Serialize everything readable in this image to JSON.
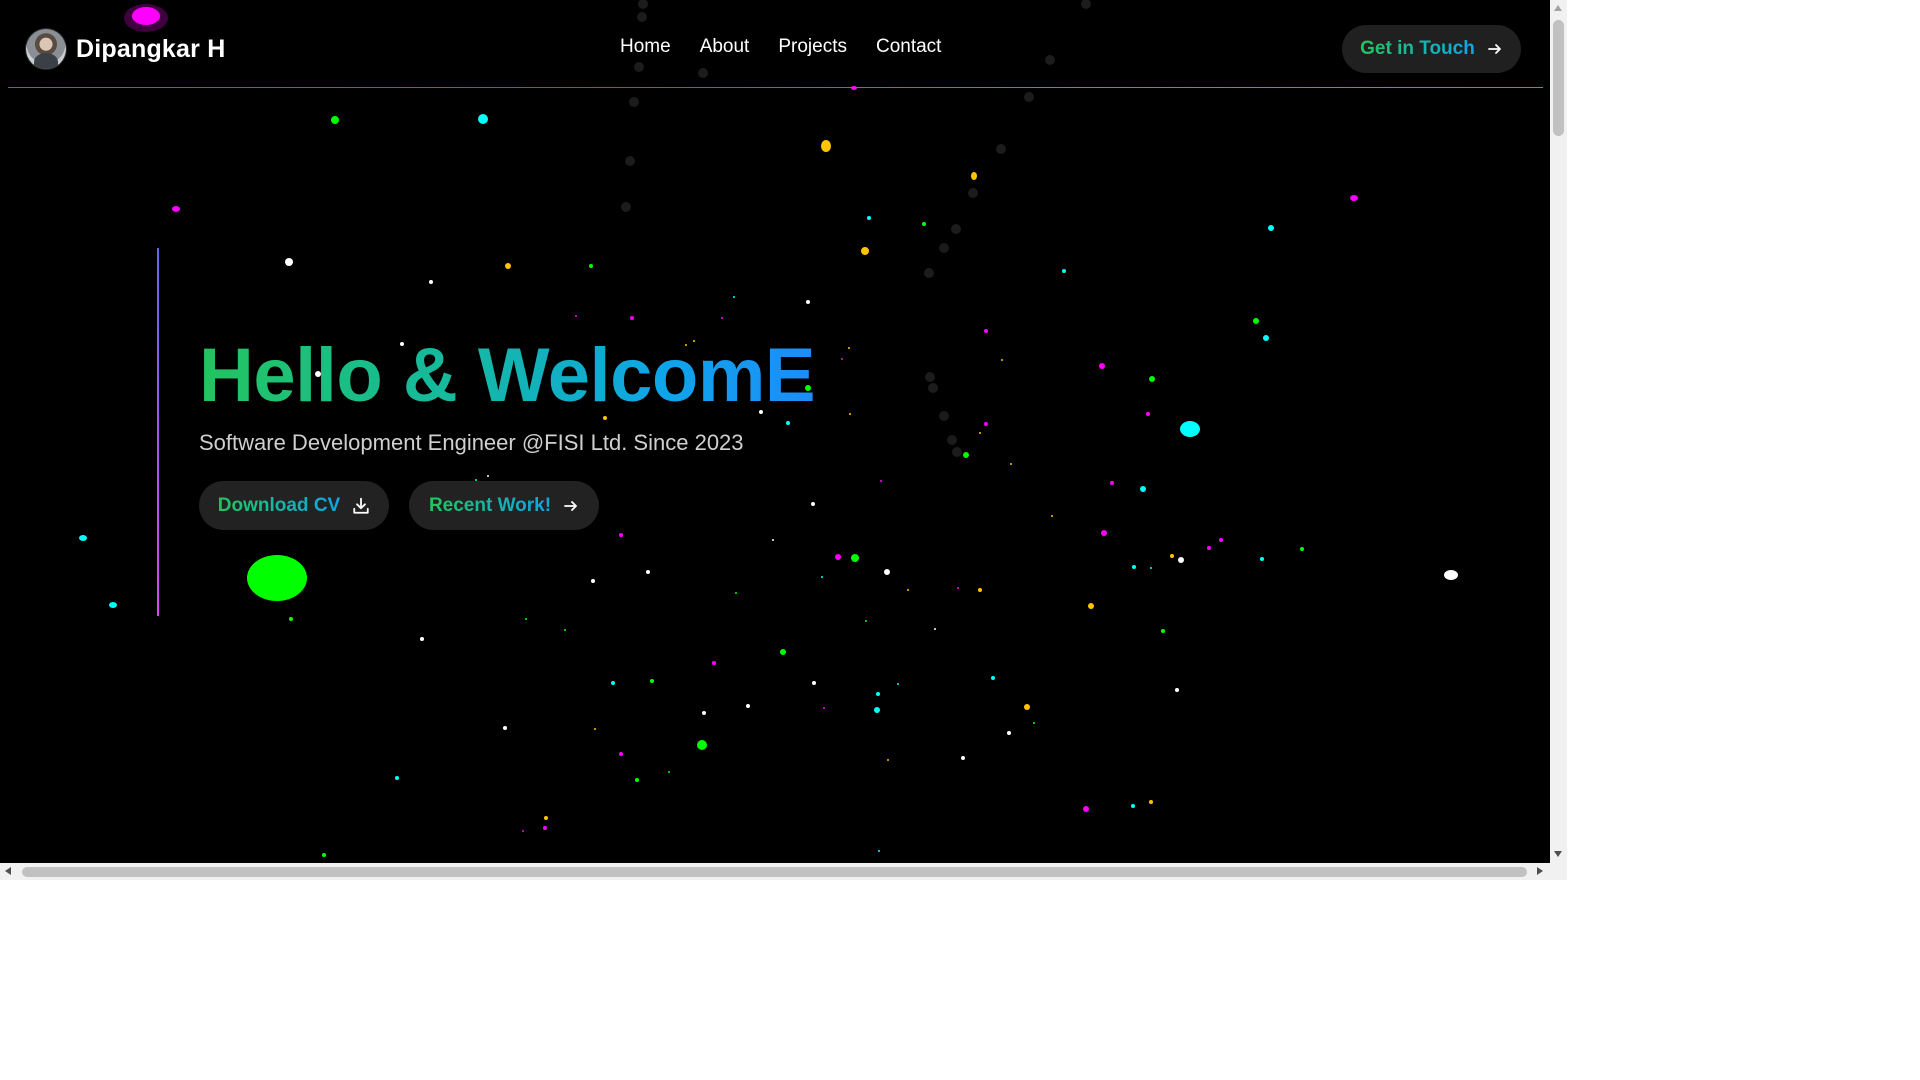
{
  "header": {
    "brand_name": "Dipangkar H",
    "nav": [
      {
        "label": "Home"
      },
      {
        "label": "About"
      },
      {
        "label": "Projects"
      },
      {
        "label": "Contact"
      }
    ],
    "cta_label": "Get in Touch",
    "cta_icon": "arrow-right-icon"
  },
  "hero": {
    "title": "Hello & WelcomE",
    "subtitle": "Software Development Engineer @FISI Ltd. Since 2023",
    "buttons": [
      {
        "label": "Download CV",
        "icon": "download-icon"
      },
      {
        "label": "Recent Work!",
        "icon": "arrow-right-icon"
      }
    ]
  },
  "colors": {
    "background": "#000000",
    "gradient_start": "#22c55e",
    "gradient_end": "#0ea5e9",
    "button_bg": "#222222",
    "particle_colors": [
      "#ff00ff",
      "#00ffff",
      "#00ff00",
      "#ffffff",
      "#ffc400"
    ]
  }
}
